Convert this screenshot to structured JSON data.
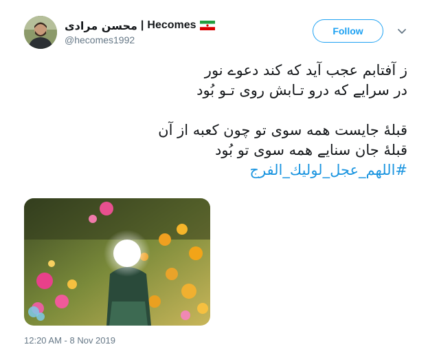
{
  "user": {
    "display_name_persian": "محسن مرادی",
    "separator": "|",
    "display_name_latin": "Hecomes",
    "handle": "@hecomes1992",
    "flag_icon": "iran-flag-icon"
  },
  "follow_button": {
    "label": "Follow",
    "color": "#1da1f2"
  },
  "menu": {
    "icon": "chevron-down-icon"
  },
  "tweet": {
    "lines": [
      "ز آفتابم عجب آید که کند دعوے نور",
      "در سرایے که درو تـابش روی تـو بُود",
      "قبلهٔ جایست همه سوی تو چون کعبه از آن",
      "قبلهٔ جان سنایے همه سوی تو بُود"
    ],
    "hashtag": "#اللهم_عجل_لولیك_الفرج",
    "hashtag_color": "#1b95e0",
    "media_alt": "flower-garden-image",
    "watermark": "…"
  },
  "timestamp": "12:20 AM - 8 Nov 2019",
  "colors": {
    "text": "#14171a",
    "secondary": "#657786",
    "background": "#ffffff"
  }
}
